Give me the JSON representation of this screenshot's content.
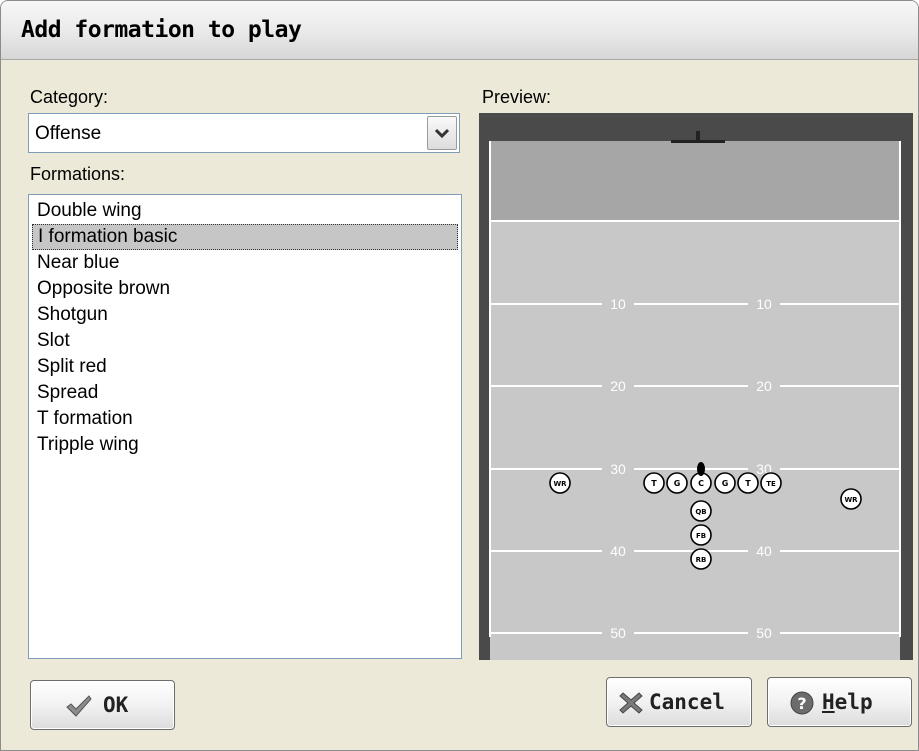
{
  "dialog": {
    "title": "Add formation to play",
    "category_label": "Category:",
    "category_value": "Offense",
    "formations_label": "Formations:",
    "preview_label": "Preview:"
  },
  "formations": {
    "items": [
      "Double wing",
      "I formation basic",
      "Near blue",
      "Opposite brown",
      "Shotgun",
      "Slot",
      "Split red",
      "Spread",
      "T formation",
      "Tripple wing"
    ],
    "selected": "I formation basic"
  },
  "preview": {
    "field_color": "#c8c8c8",
    "endzone_color": "#a6a6a6",
    "frame_color": "#4a4a4a",
    "yard_lines": [
      "10",
      "20",
      "30",
      "40",
      "50"
    ],
    "players": [
      "WR",
      "T",
      "G",
      "C",
      "G",
      "T",
      "TE",
      "QB",
      "FB",
      "RB",
      "WR"
    ]
  },
  "buttons": {
    "ok": {
      "label": "OK",
      "icon": "checkmark-icon"
    },
    "cancel": {
      "label": "Cancel",
      "icon": "cross-icon"
    },
    "help": {
      "label_underlined": "H",
      "label_rest": "elp",
      "icon": "help-icon"
    }
  }
}
